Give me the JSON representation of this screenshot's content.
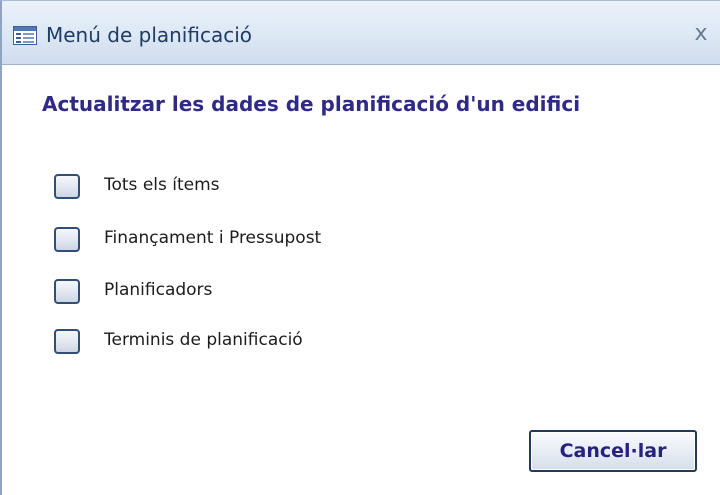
{
  "window": {
    "title": "Menú de planificació",
    "close_symbol": "x"
  },
  "heading": "Actualitzar les dades de planificació d'un edifici",
  "options": [
    {
      "label": "Tots els ítems",
      "checked": false
    },
    {
      "label": "Finançament i Pressupost",
      "checked": false
    },
    {
      "label": "Planificadors",
      "checked": false
    },
    {
      "label": "Terminis de planificació",
      "checked": false
    }
  ],
  "buttons": {
    "cancel_label": "Cancel·lar"
  },
  "icons": {
    "app": "form-icon",
    "close": "close-icon",
    "checkbox": "checkbox-icon"
  },
  "colors": {
    "title_text": "#1f3b66",
    "heading_text": "#2f2a87",
    "button_text": "#27227d",
    "titlebar_background": "#dde8f5",
    "checkbox_border": "#2f4f78"
  }
}
